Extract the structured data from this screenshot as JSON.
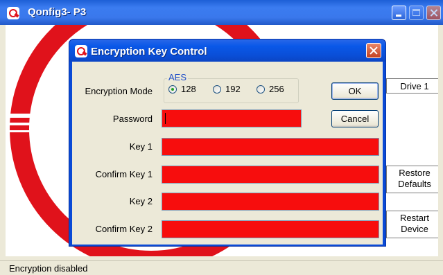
{
  "main_window": {
    "title": "Qonfig3- P3",
    "buttons": {
      "drive": "Drive 1",
      "restore_line1": "Restore",
      "restore_line2": "Defaults",
      "restart_line1": "Restart",
      "restart_line2": "Device"
    },
    "status": "Encryption disabled"
  },
  "dialog": {
    "title": "Encryption Key Control",
    "mode_label": "Encryption Mode",
    "group_title": "AES",
    "modes": [
      {
        "label": "128",
        "selected": true
      },
      {
        "label": "192",
        "selected": false
      },
      {
        "label": "256",
        "selected": false
      }
    ],
    "fields": [
      {
        "label": "Password",
        "value": ""
      },
      {
        "label": "Key 1",
        "value": ""
      },
      {
        "label": "Confirm Key 1",
        "value": ""
      },
      {
        "label": "Key 2",
        "value": ""
      },
      {
        "label": "Confirm Key 2",
        "value": ""
      }
    ],
    "ok_label": "OK",
    "cancel_label": "Cancel"
  },
  "colors": {
    "field_fill": "#f70d0d",
    "title_blue": "#0a4fd8",
    "logo_red": "#e0121b"
  },
  "icons": [
    "app-logo-icon",
    "minimize-icon",
    "maximize-icon",
    "close-icon"
  ]
}
